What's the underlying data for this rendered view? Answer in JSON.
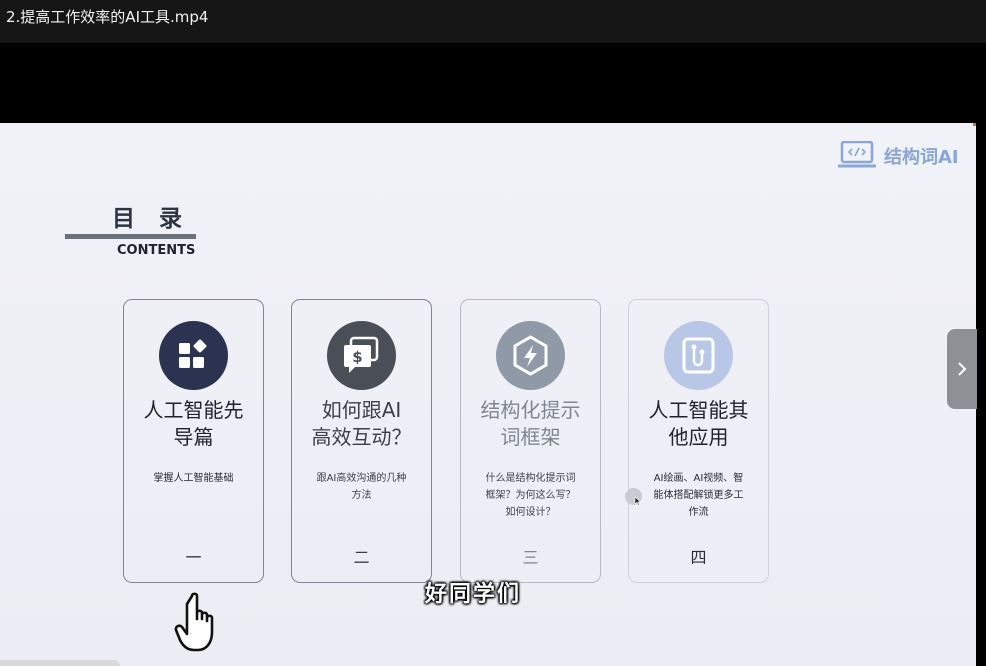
{
  "window": {
    "title": "2.提高工作效率的AI工具.mp4"
  },
  "slide": {
    "logo": {
      "brand": "结构词AI"
    },
    "toc": {
      "title": "目录",
      "subtitle": "CONTENTS"
    },
    "cards": [
      {
        "title": "人工智能先\n导篇",
        "desc": "掌握人工智能基础",
        "num": "一",
        "icon": "grid-apps-icon",
        "icon_color": "#2c3350"
      },
      {
        "title": "如何跟AI\n高效互动？",
        "desc": "跟AI高效沟通的几种\n方法",
        "num": "二",
        "icon": "chat-dollar-icon",
        "icon_color": "#4a4f57"
      },
      {
        "title": "结构化提示\n词框架",
        "desc": "什么是结构化提示词\n框架？为何这么写？\n如何设计？",
        "num": "三",
        "icon": "hexagon-bolt-icon",
        "icon_color": "#8f99a8"
      },
      {
        "title": "人工智能其\n他应用",
        "desc": "AI绘画、AI视频、智\n能体搭配解锁更多工\n作流",
        "num": "四",
        "icon": "phone-link-icon",
        "icon_color": "#b8c7e6"
      }
    ]
  },
  "subtitle": "好同学们",
  "colors": {
    "accent": "#8aa6d6",
    "dark": "#2c3350"
  }
}
